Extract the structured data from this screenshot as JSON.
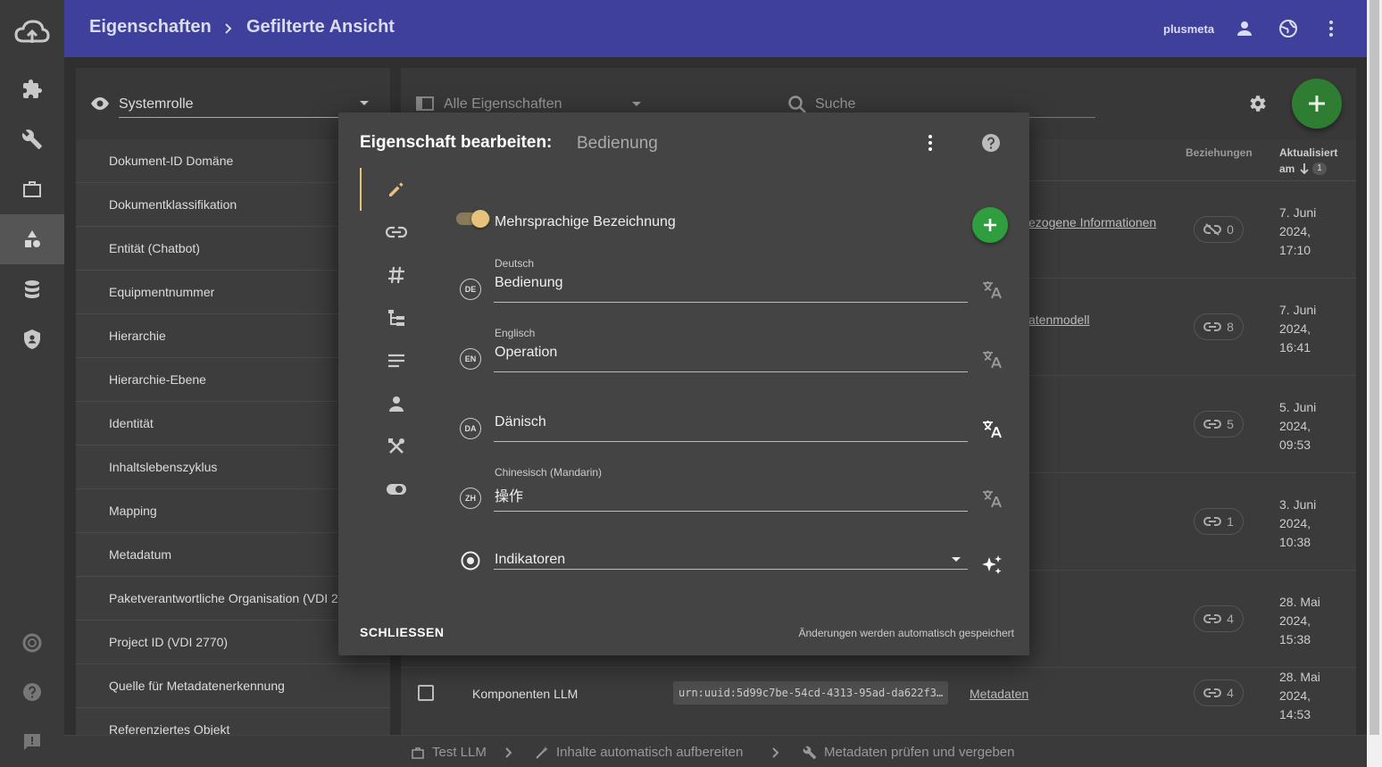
{
  "topbar": {
    "breadcrumb_root": "Eigenschaften",
    "breadcrumb_current": "Gefilterte Ansicht",
    "username": "plusmeta"
  },
  "leftpanel": {
    "filter_label": "Systemrolle",
    "items": [
      {
        "label": "Dokument-ID Domäne"
      },
      {
        "label": "Dokumentklassifikation"
      },
      {
        "label": "Entität (Chatbot)"
      },
      {
        "label": "Equipmentnummer"
      },
      {
        "label": "Hierarchie"
      },
      {
        "label": "Hierarchie-Ebene"
      },
      {
        "label": "Identität"
      },
      {
        "label": "Inhaltslebenszyklus"
      },
      {
        "label": "Mapping"
      },
      {
        "label": "Metadatum"
      },
      {
        "label": "Paketverantwortliche Organisation (VDI 27"
      },
      {
        "label": "Project ID (VDI 2770)"
      },
      {
        "label": "Quelle für Metadatenerkennung"
      },
      {
        "label": "Referenziertes Objekt"
      }
    ]
  },
  "main": {
    "view_select": "Alle Eigenschaften",
    "search_placeholder": "Suche",
    "col_relations": "Beziehungen",
    "col_updated_line1": "Aktualisiert",
    "col_updated_line2": "am",
    "sort_rank": "1",
    "rows": [
      {
        "relation": "ezogene Informationen",
        "count": "0",
        "unlinked": true,
        "date1": "7. Juni",
        "date2": "2024,",
        "date3": "17:10"
      },
      {
        "relation": "atenmodell",
        "count": "8",
        "unlinked": false,
        "date1": "7. Juni",
        "date2": "2024,",
        "date3": "16:41"
      },
      {
        "relation": "",
        "count": "5",
        "unlinked": false,
        "date1": "5. Juni",
        "date2": "2024,",
        "date3": "09:53"
      },
      {
        "relation": "",
        "count": "1",
        "unlinked": false,
        "date1": "3. Juni",
        "date2": "2024,",
        "date3": "10:38"
      },
      {
        "relation": "",
        "count": "4",
        "unlinked": false,
        "date1": "28. Mai",
        "date2": "2024,",
        "date3": "15:38"
      }
    ],
    "last_row": {
      "name": "Komponenten LLM",
      "uuid": "urn:uuid:5d99c7be-54cd-4313-95ad-da622f3…",
      "relation": "Metadaten",
      "count": "4",
      "date1": "28. Mai",
      "date2": "2024,",
      "date3": "14:53"
    }
  },
  "bottombar": {
    "step1": "Test LLM",
    "step2": "Inhalte automatisch aufbereiten",
    "step3": "Metadaten prüfen und vergeben"
  },
  "modal": {
    "title": "Eigenschaft bearbeiten:",
    "subtitle": "Bedienung",
    "toggle_label": "Mehrsprachige Bezeichnung",
    "languages": [
      {
        "code": "DE",
        "label": "Deutsch",
        "value": "Bedienung"
      },
      {
        "code": "EN",
        "label": "Englisch",
        "value": "Operation"
      },
      {
        "code": "DA",
        "label": "",
        "value": "Dänisch"
      },
      {
        "code": "ZH",
        "label": "Chinesisch (Mandarin)",
        "value": "操作"
      }
    ],
    "indicator_select": "Indikatoren",
    "close_label": "SCHLIESSEN",
    "autosave_note": "Änderungen werden automatisch gespeichert"
  },
  "colors": {
    "topbar": "#3f3f9c",
    "accent_green": "#2e7d32",
    "toggle_thumb": "#e7c27a"
  }
}
